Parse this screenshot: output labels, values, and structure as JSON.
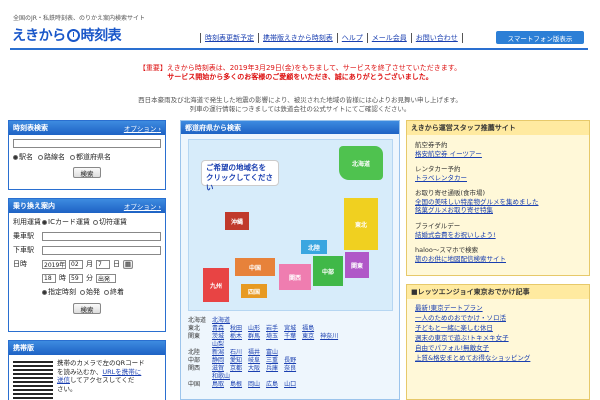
{
  "header": {
    "tagline": "全国のJR・私鉄時刻表、のりかえ案内検索サイト",
    "logo": "えきから時刻表",
    "nav": [
      "時刻表更新予定",
      "携帯版えきから時刻表",
      "ヘルプ",
      "メール会員",
      "お問い合わせ"
    ],
    "smartphone_button": "スマートフォン版表示"
  },
  "notice": {
    "lines": [
      "【重要】えきから時刻表は、2019年3月29日(金)をもちまして、サービスを終了させていただきます。",
      "サービス開始から多くのお客様のご愛顧をいただき、誠にありがとうございました。"
    ],
    "sub": [
      "西日本豪雨及び北海道で発生した地震の影響により、被災された地域の皆様には心よりお見舞い申し上げます。",
      "列車の運行情報につきましては鉄道会社の公式サイトにてご確認ください。"
    ]
  },
  "timetable": {
    "title": "時刻表検索",
    "option": "オプション",
    "radios": [
      "駅名",
      "路線名",
      "都道府県名"
    ],
    "search": "検索"
  },
  "transfer": {
    "title": "乗り換え案内",
    "option": "オプション",
    "service_label": "利用運賃",
    "service": [
      "ICカード運賃",
      "切符運賃"
    ],
    "from_label": "乗車駅",
    "to_label": "下車駅",
    "date_label": "日時",
    "year": "2019年",
    "month": "02",
    "day": "7",
    "month_unit": "月",
    "day_unit": "日",
    "hour": "18",
    "minute": "59",
    "hour_unit": "時",
    "minute_unit": "分",
    "dep": "出発",
    "timeopts": [
      "指定時刻",
      "始発",
      "終着"
    ],
    "search": "検索"
  },
  "mobile": {
    "title": "携帯版",
    "text": [
      "携帯のカメラで左のQRコード",
      "を読み込むか、",
      "URLを携帯に",
      "送信",
      "してアクセスしてくだ",
      "さい。"
    ]
  },
  "map": {
    "title": "都道府県から検索",
    "bubble": [
      "ご希望の地域名を",
      "クリックしてください"
    ],
    "regions": [
      "北海道",
      "東北",
      "関東",
      "北陸",
      "中部",
      "関西",
      "中国",
      "四国",
      "九州",
      "沖縄"
    ],
    "rows": [
      {
        "k": "北海道",
        "v": [
          "北海道"
        ]
      },
      {
        "k": "東北",
        "v": [
          "青森",
          "秋田",
          "山形",
          "岩手",
          "宮城",
          "福島"
        ]
      },
      {
        "k": "関東",
        "v": [
          "茨城",
          "栃木",
          "群馬",
          "埼玉",
          "千葉",
          "東京",
          "神奈川"
        ]
      },
      {
        "k": "",
        "v": [
          "山梨"
        ]
      },
      {
        "k": "北陸",
        "v": [
          "新潟",
          "石川",
          "福井",
          "富山"
        ]
      },
      {
        "k": "中部",
        "v": [
          "静岡",
          "愛知",
          "岐阜",
          "三重",
          "長野"
        ]
      },
      {
        "k": "関西",
        "v": [
          "滋賀",
          "京都",
          "大阪",
          "兵庫",
          "奈良"
        ]
      },
      {
        "k": "",
        "v": [
          "和歌山"
        ]
      },
      {
        "k": "中国",
        "v": [
          "鳥取",
          "島根",
          "岡山",
          "広島",
          "山口"
        ]
      }
    ]
  },
  "staff": {
    "title": "えきから運営スタッフ推薦サイト",
    "items": [
      {
        "t": "航空券予約",
        "l": "格安航空券 イーツアー"
      },
      {
        "t": "レンタカー予約",
        "l": "トラベレンタカー"
      },
      {
        "t": "お取り寄せ通販(食市場)",
        "l": "全国の美味しい特産物グルメを集めました",
        "l2": "銘菓グルメお取り寄せ特集"
      },
      {
        "t": "ブライダルデー",
        "l": "結婚式会費をお祝いしよう!"
      },
      {
        "t": "haloo〜スマホで検索",
        "l": "旅のお供に地図配信検索サイト"
      }
    ]
  },
  "leisure": {
    "title": "レッツエンジョイ東京おでかけ記事",
    "items": [
      "最新!東京デートプラン",
      "一人のためのおでかけ・ソロ活",
      "子どもと一緒に楽しむ休日",
      "週末の東京で遊ぶ!トキメキ女子",
      "自由でパフォル!無敵女子",
      "上質&格安まとめてお得なショッピング"
    ]
  }
}
